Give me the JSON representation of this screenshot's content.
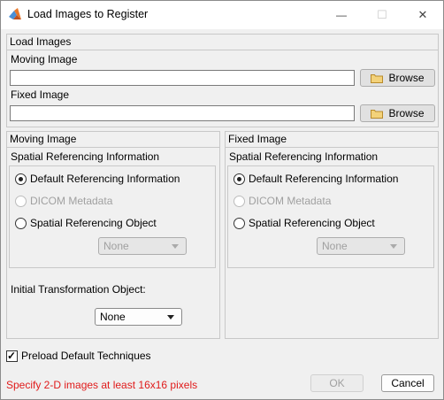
{
  "window": {
    "title": "Load Images to Register",
    "minimize_glyph": "—",
    "maximize_glyph": "☐",
    "close_glyph": "✕"
  },
  "load_images": {
    "title": "Load Images",
    "moving_label": "Moving Image",
    "moving_value": "",
    "fixed_label": "Fixed Image",
    "fixed_value": "",
    "browse_label": "Browse"
  },
  "moving_panel": {
    "title": "Moving Image",
    "spatial_title": "Spatial Referencing Information",
    "options": [
      "Default Referencing Information",
      "DICOM Metadata",
      "Spatial Referencing Object"
    ],
    "selected_index": 0,
    "object_dropdown": "None",
    "init_transform_label": "Initial Transformation Object:",
    "init_transform_value": "None"
  },
  "fixed_panel": {
    "title": "Fixed Image",
    "spatial_title": "Spatial Referencing Information",
    "options": [
      "Default Referencing Information",
      "DICOM Metadata",
      "Spatial Referencing Object"
    ],
    "selected_index": 0,
    "object_dropdown": "None"
  },
  "preload": {
    "label": "Preload Default Techniques",
    "checked": true,
    "check_glyph": "✓"
  },
  "footer": {
    "status": "Specify 2-D images at least 16x16 pixels",
    "ok_label": "OK",
    "cancel_label": "Cancel"
  },
  "colors": {
    "status": "#e01b1b",
    "folder": "#f3d27a"
  }
}
